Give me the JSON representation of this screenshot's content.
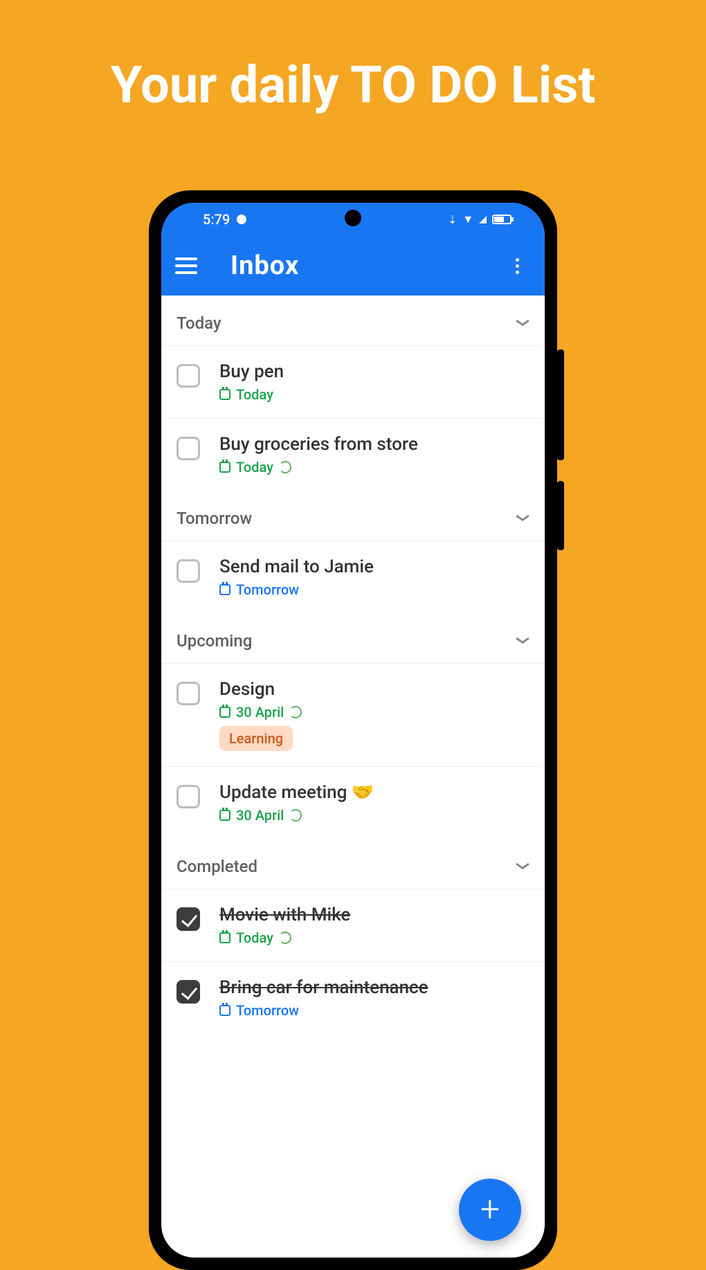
{
  "promo": {
    "title": "Your daily TO DO List"
  },
  "status": {
    "time": "5:79"
  },
  "appbar": {
    "title": "Inbox"
  },
  "sections": {
    "today": {
      "label": "Today",
      "items": [
        {
          "title": "Buy pen",
          "due": "Today",
          "meta_color": "green",
          "has_repeat": false
        },
        {
          "title": "Buy groceries from store",
          "due": "Today",
          "meta_color": "green",
          "has_repeat": true
        }
      ]
    },
    "tomorrow": {
      "label": "Tomorrow",
      "items": [
        {
          "title": "Send mail to Jamie",
          "due": "Tomorrow",
          "meta_color": "blue",
          "has_repeat": false
        }
      ]
    },
    "upcoming": {
      "label": "Upcoming",
      "items": [
        {
          "title": "Design",
          "due": "30 April",
          "meta_color": "green",
          "has_repeat": true,
          "tag": "Learning"
        },
        {
          "title": "Update meeting 🤝",
          "due": "30 April",
          "meta_color": "green",
          "has_repeat": true
        }
      ]
    },
    "completed": {
      "label": "Completed",
      "items": [
        {
          "title": "Movie with Mike",
          "due": "Today",
          "meta_color": "green",
          "has_repeat": true,
          "completed": true
        },
        {
          "title": "Bring car for maintenance",
          "due": "Tomorrow",
          "meta_color": "blue",
          "has_repeat": false,
          "completed": true
        }
      ]
    }
  },
  "fab": {
    "label": "+"
  }
}
